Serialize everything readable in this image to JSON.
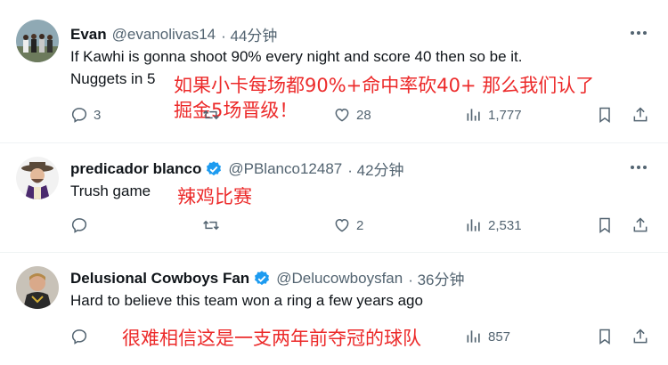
{
  "colors": {
    "overlay_red": "#ec2a2a",
    "verified_blue": "#1d9bf0",
    "meta_gray": "#536471"
  },
  "tweets": [
    {
      "name": "Evan",
      "handle": "@evanolivas14",
      "time": "· 44分钟",
      "verified": false,
      "text_lines": [
        "If Kawhi is gonna shoot 90% every night and score 40 then so be it.",
        "Nuggets in 5"
      ],
      "overlay_lines": [
        "如果小卡每场都90%+命中率砍40+ 那么我们认了",
        "掘金5场晋级！"
      ],
      "replies": "3",
      "retweets": "",
      "likes": "28",
      "views": "1,777",
      "icons": [
        "reply-icon",
        "retweet-icon",
        "like-icon",
        "views-icon",
        "bookmark-icon",
        "share-icon",
        "more-icon"
      ]
    },
    {
      "name": "predicador blanco",
      "handle": "@PBlanco12487",
      "time": "· 42分钟",
      "verified": true,
      "text_lines": [
        "Trush game"
      ],
      "overlay_lines": [
        "辣鸡比赛"
      ],
      "replies": "",
      "retweets": "",
      "likes": "2",
      "views": "2,531"
    },
    {
      "name": "Delusional Cowboys Fan",
      "handle": "@Delucowboysfan",
      "time": "· 36分钟",
      "verified": true,
      "text_lines": [
        "Hard to believe this team won a ring a few years ago"
      ],
      "overlay_lines": [
        "很难相信这是一支两年前夺冠的球队"
      ],
      "replies": "",
      "retweets": "",
      "likes": "",
      "views": "857"
    }
  ]
}
